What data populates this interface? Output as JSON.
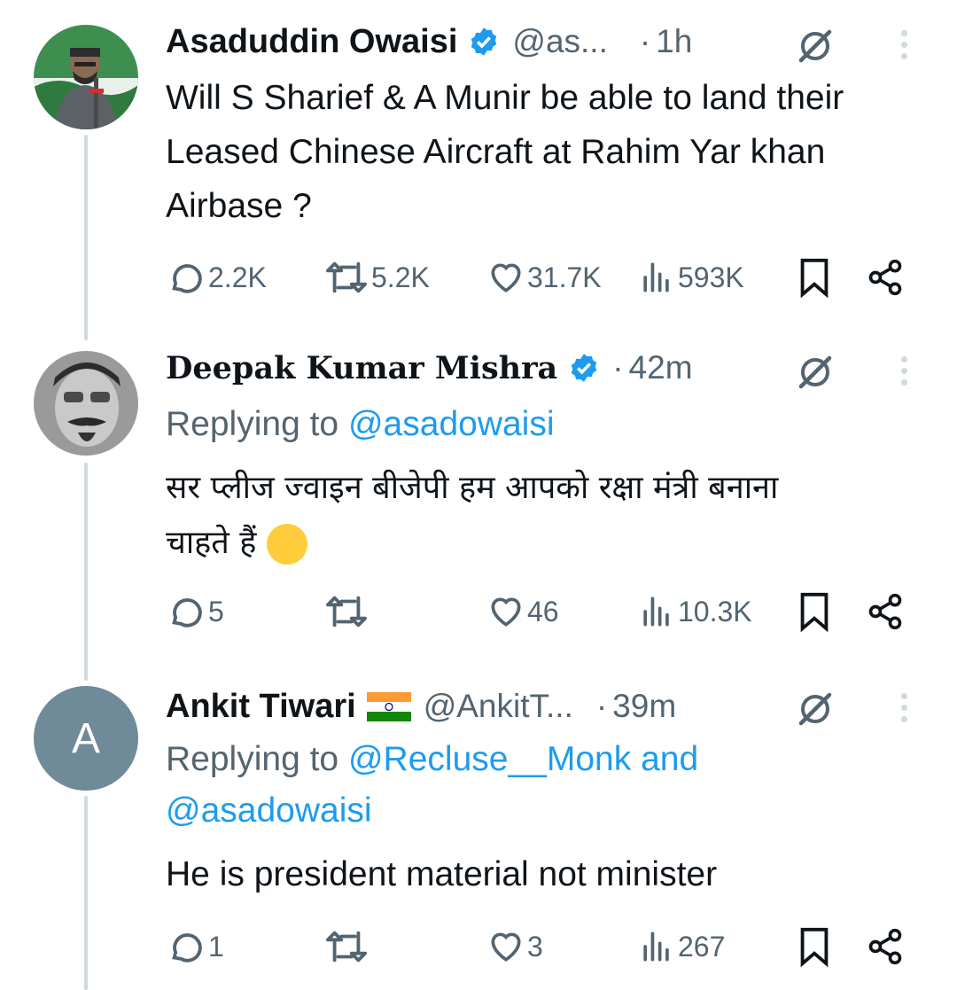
{
  "colors": {
    "text": "#0f1419",
    "muted": "#536471",
    "link": "#1d9bf0",
    "verified": "#1d9bf0",
    "thread_line": "#cfd9de"
  },
  "tweets": [
    {
      "name": "Asaduddin Owaisi",
      "handle": "@as...",
      "dot": "·",
      "time": "1h",
      "verified": true,
      "text": "Will S Sharief & A Munir be able to  land their Leased Chinese Aircraft at Rahim Yar khan Airbase ?",
      "replies": "2.2K",
      "reposts": "5.2K",
      "likes": "31.7K",
      "views": "593K",
      "icons": [
        "reply-icon",
        "repost-icon",
        "like-icon",
        "views-icon",
        "bookmark-icon",
        "share-icon",
        "grok-icon",
        "more-icon"
      ]
    },
    {
      "name": "Deepak Kumar Mishra",
      "dot": "·",
      "time": "42m",
      "verified": true,
      "replying_label": "Replying to",
      "replying_to": "@asadowaisi",
      "text_line1": "सर प्लीज ज्वाइन बीजेपी हम आपको रक्षा मंत्री बनाना",
      "text_line2": "चाहते हैं",
      "emoji": "🥹",
      "replies": "5",
      "reposts": "",
      "likes": "46",
      "views": "10.3K"
    },
    {
      "name": "Ankit Tiwari",
      "flag": "india-flag",
      "handle": "@AnkitT...",
      "dot": "·",
      "time": "39m",
      "avatar_letter": "A",
      "replying_label": "Replying to",
      "replying_to_1": "@Recluse__Monk",
      "replying_and": "and",
      "replying_to_2": "@asadowaisi",
      "text": "He is president material not minister",
      "replies": "1",
      "reposts": "",
      "likes": "3",
      "views": "267"
    }
  ]
}
